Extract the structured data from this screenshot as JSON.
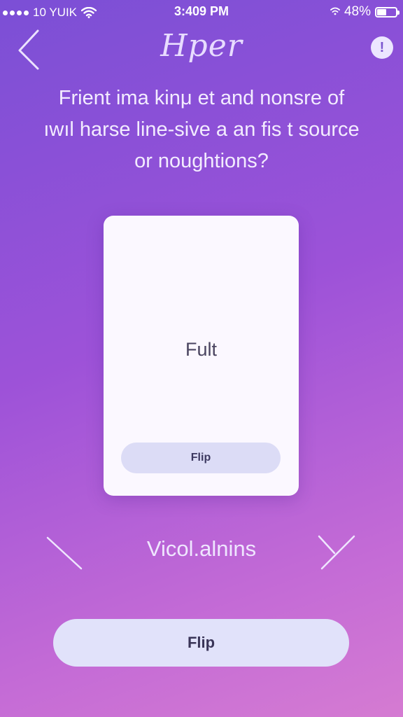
{
  "status_bar": {
    "carrier": "10 YUIK",
    "time": "3:409 PM",
    "battery": "48%",
    "battery_level": 0.48
  },
  "header": {
    "title": "Hper",
    "back_icon": "chevron-left-icon",
    "info_icon": "info-icon",
    "info_glyph": "!"
  },
  "question": {
    "line1": "Frient ima kinμ et and nonsre of",
    "line2": "ıwıl harse line-sive a an fis t source",
    "line3": "or noughtions?"
  },
  "card": {
    "text": "Fult",
    "flip_label": "Flip"
  },
  "navigation": {
    "label": "Vicol.alnins",
    "prev_icon": "diagonal-prev-icon",
    "next_icon": "diagonal-next-icon"
  },
  "footer": {
    "flip_label": "Flip"
  },
  "colors": {
    "gradient_start": "#7b4fd6",
    "gradient_end": "#d57bd2",
    "card_background": "#fbf8ff",
    "button_background": "#e1e2fa"
  }
}
